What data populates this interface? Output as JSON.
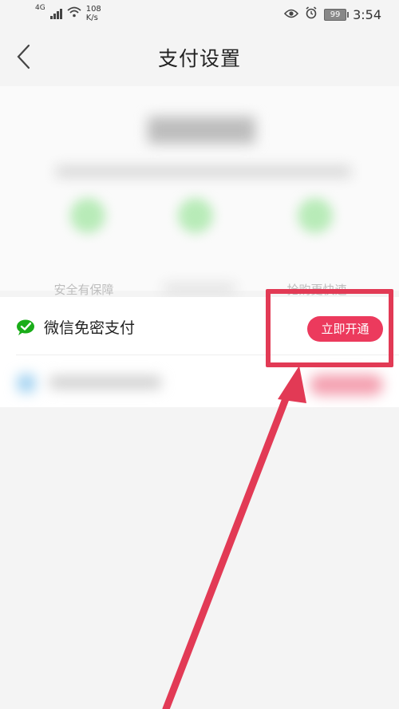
{
  "status_bar": {
    "network": "4G",
    "speed_value": "108",
    "speed_unit": "K/s",
    "battery": "99",
    "time": "3:54"
  },
  "header": {
    "title": "支付设置"
  },
  "intro": {
    "features": [
      {
        "label": "安全有保障"
      },
      {
        "label": ""
      },
      {
        "label": "抢购更快速"
      }
    ]
  },
  "settings": {
    "wechat": {
      "label": "微信免密支付",
      "button_label": "立即开通"
    }
  },
  "colors": {
    "accent": "#ec3a5d",
    "annotation": "#e23a55",
    "wechat_green": "#1aad19"
  }
}
